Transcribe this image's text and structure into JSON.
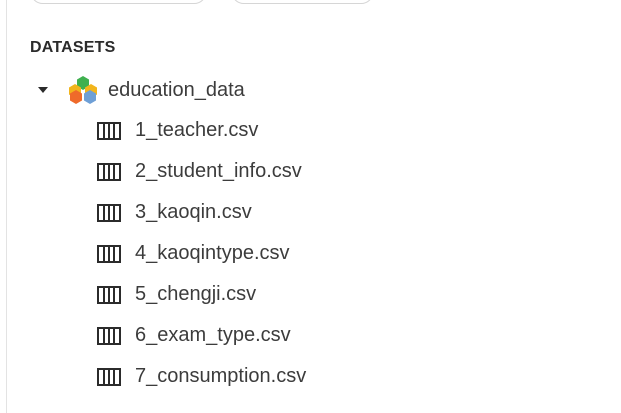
{
  "sidebar": {
    "section_title": "DATASETS",
    "dataset": {
      "name": "education_data",
      "icon": "dataset-hexagon-icon",
      "expanded": true
    },
    "files": [
      {
        "label": "1_teacher.csv",
        "icon": "table-icon"
      },
      {
        "label": "2_student_info.csv",
        "icon": "table-icon"
      },
      {
        "label": "3_kaoqin.csv",
        "icon": "table-icon"
      },
      {
        "label": "4_kaoqintype.csv",
        "icon": "table-icon"
      },
      {
        "label": "5_chengji.csv",
        "icon": "table-icon"
      },
      {
        "label": "6_exam_type.csv",
        "icon": "table-icon"
      },
      {
        "label": "7_consumption.csv",
        "icon": "table-icon"
      }
    ]
  },
  "colors": {
    "text": "#3c3c3c",
    "heading": "#2b2b2b",
    "hex_green": "#3fb04f",
    "hex_yellow": "#f2b51c",
    "hex_orange": "#ef6a2a",
    "hex_blue": "#6e9fd6"
  }
}
